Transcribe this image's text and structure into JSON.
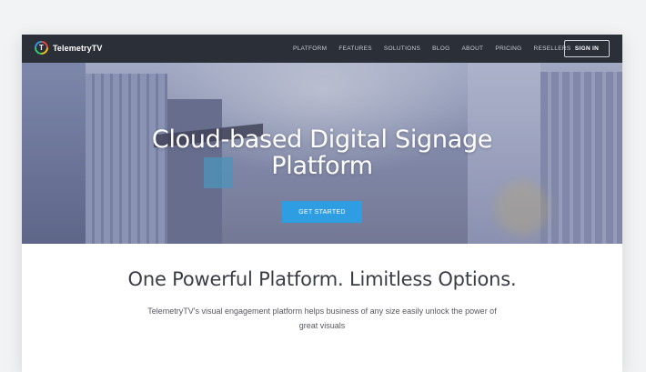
{
  "nav": {
    "brand": "TelemetryTV",
    "logo_letter": "T",
    "links": [
      "PLATFORM",
      "FEATURES",
      "SOLUTIONS",
      "BLOG",
      "ABOUT",
      "PRICING",
      "RESELLERS"
    ],
    "signin_label": "SIGN IN"
  },
  "hero": {
    "title_line1": "Cloud-based Digital Signage",
    "title_line2": "Platform",
    "cta_label": "GET STARTED"
  },
  "section": {
    "title": "One Powerful Platform. Limitless Options.",
    "line1": "TelemetryTV's visual engagement platform helps business of any size easily unlock the power of",
    "line2": "great visuals"
  },
  "colors": {
    "nav_bg": "#2b2f38",
    "cta": "#2f9de2",
    "page_bg": "#f2f3f5"
  }
}
